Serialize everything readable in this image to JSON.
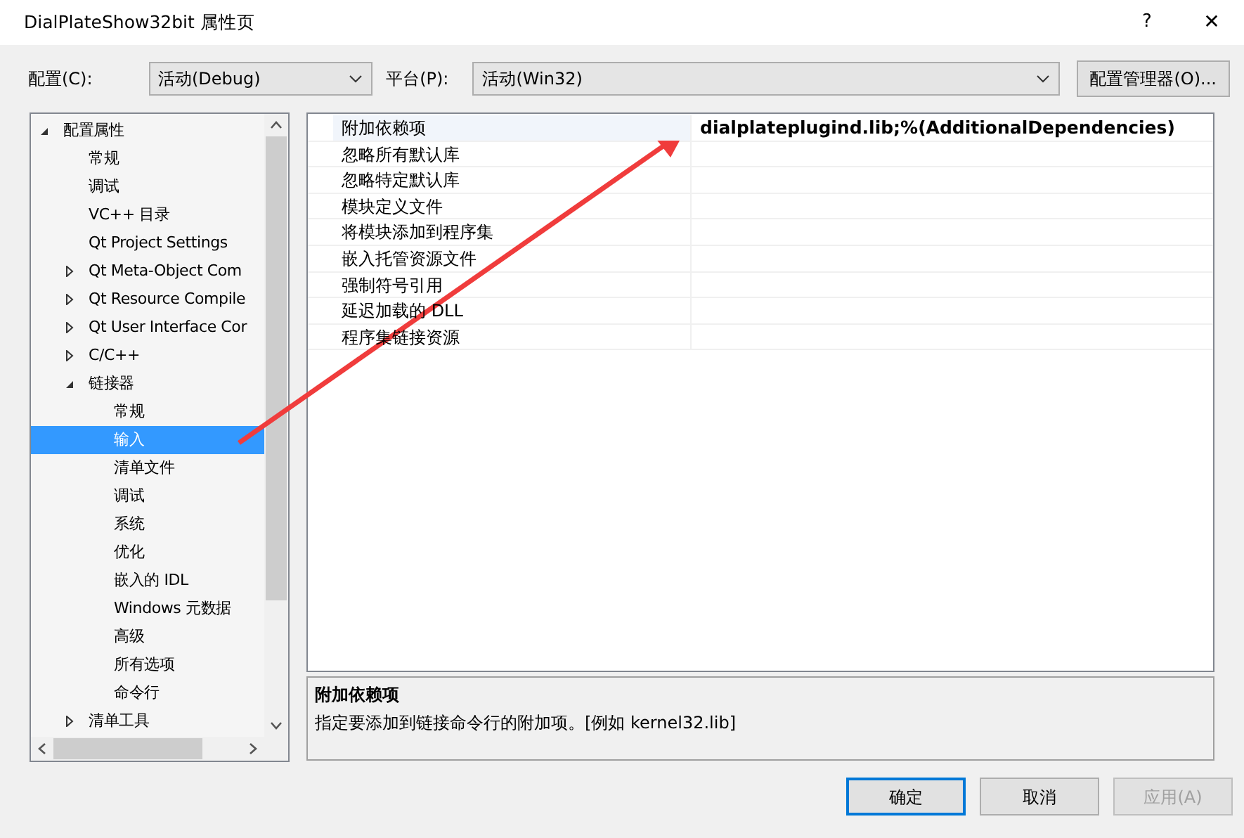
{
  "window": {
    "title": "DialPlateShow32bit 属性页",
    "help": "?",
    "close": "✕"
  },
  "toolbar": {
    "config_label": "配置(C):",
    "config_value": "活动(Debug)",
    "platform_label": "平台(P):",
    "platform_value": "活动(Win32)",
    "manager_button": "配置管理器(O)..."
  },
  "tree": [
    {
      "label": "配置属性",
      "expanded": true,
      "selected": false,
      "children": [
        {
          "label": "常规",
          "selected": false
        },
        {
          "label": "调试",
          "selected": false
        },
        {
          "label": "VC++ 目录",
          "selected": false
        },
        {
          "label": "Qt Project Settings",
          "selected": false
        },
        {
          "label": "Qt Meta-Object Com",
          "expanded": false,
          "selected": false
        },
        {
          "label": "Qt Resource Compile",
          "expanded": false,
          "selected": false
        },
        {
          "label": "Qt User Interface Cor",
          "expanded": false,
          "selected": false
        },
        {
          "label": "C/C++",
          "expanded": false,
          "selected": false
        },
        {
          "label": "链接器",
          "expanded": true,
          "selected": false,
          "children": [
            {
              "label": "常规",
              "selected": false
            },
            {
              "label": "输入",
              "selected": true
            },
            {
              "label": "清单文件",
              "selected": false
            },
            {
              "label": "调试",
              "selected": false
            },
            {
              "label": "系统",
              "selected": false
            },
            {
              "label": "优化",
              "selected": false
            },
            {
              "label": "嵌入的 IDL",
              "selected": false
            },
            {
              "label": "Windows 元数据",
              "selected": false
            },
            {
              "label": "高级",
              "selected": false
            },
            {
              "label": "所有选项",
              "selected": false
            },
            {
              "label": "命令行",
              "selected": false
            }
          ]
        },
        {
          "label": "清单工具",
          "expanded": false,
          "selected": false
        }
      ]
    }
  ],
  "properties": [
    {
      "name": "附加依赖项",
      "value": "dialplateplugind.lib;%(AdditionalDependencies)",
      "selected": true
    },
    {
      "name": "忽略所有默认库",
      "selected": false
    },
    {
      "name": "忽略特定默认库",
      "selected": false
    },
    {
      "name": "模块定义文件",
      "selected": false
    },
    {
      "name": "将模块添加到程序集",
      "selected": false
    },
    {
      "name": "嵌入托管资源文件",
      "selected": false
    },
    {
      "name": "强制符号引用",
      "selected": false
    },
    {
      "name": "延迟加载的 DLL",
      "selected": false
    },
    {
      "name": "程序集链接资源",
      "selected": false
    }
  ],
  "description": {
    "title": "附加依赖项",
    "text": "指定要添加到链接命令行的附加项。[例如 kernel32.lib]"
  },
  "buttons": [
    {
      "label": "确定",
      "kind": "default",
      "disabled": false
    },
    {
      "label": "取消",
      "kind": "normal",
      "disabled": false
    },
    {
      "label": "应用(A)",
      "kind": "normal",
      "disabled": true
    }
  ]
}
